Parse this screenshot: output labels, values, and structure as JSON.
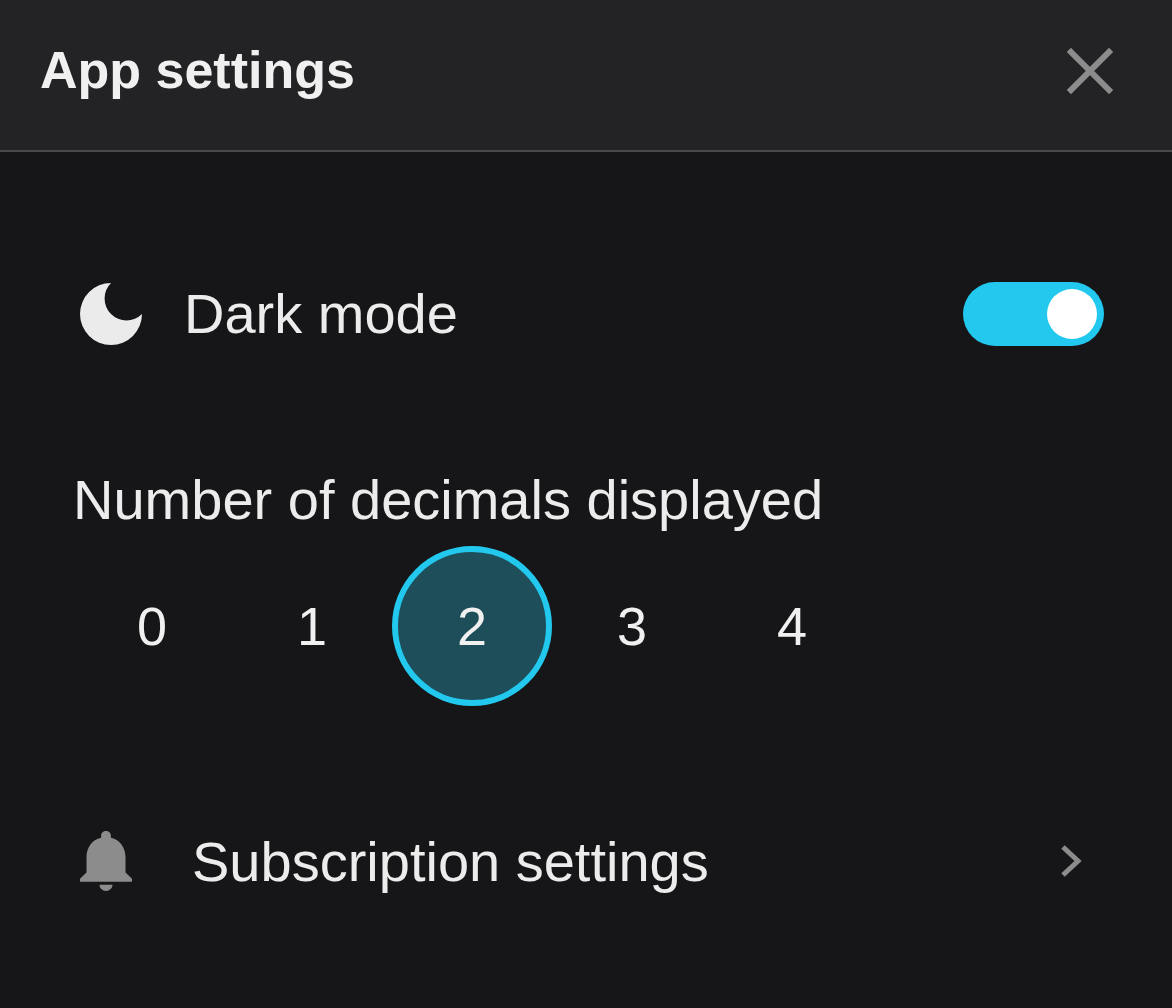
{
  "header": {
    "title": "App settings"
  },
  "dark_mode": {
    "label": "Dark mode",
    "on": true
  },
  "decimals": {
    "label": "Number of decimals displayed",
    "options": [
      {
        "label": "0",
        "selected": false
      },
      {
        "label": "1",
        "selected": false
      },
      {
        "label": "2",
        "selected": true
      },
      {
        "label": "3",
        "selected": false
      },
      {
        "label": "4",
        "selected": false
      }
    ]
  },
  "subscription": {
    "label": "Subscription settings"
  }
}
